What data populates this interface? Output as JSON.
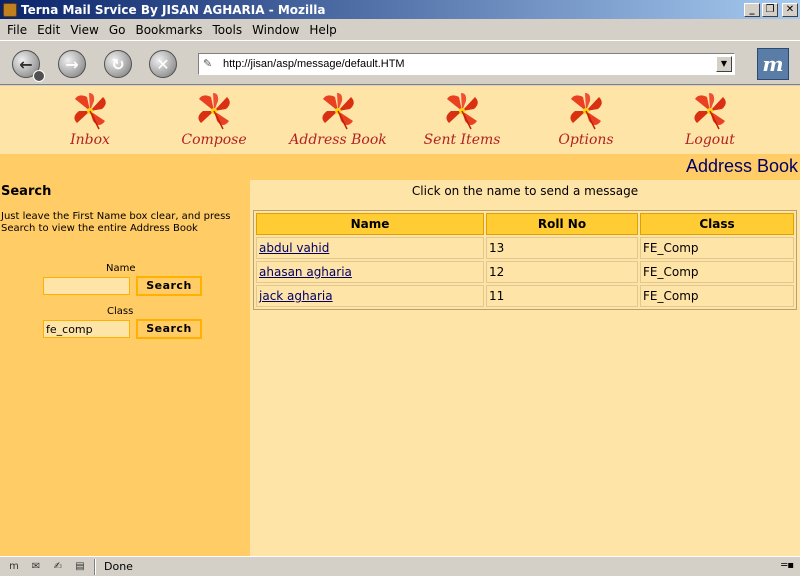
{
  "window": {
    "title": "Terna Mail Srvice By JISAN AGHARIA - Mozilla",
    "controls": [
      "_",
      "❐",
      "✕"
    ]
  },
  "menu": [
    "File",
    "Edit",
    "View",
    "Go",
    "Bookmarks",
    "Tools",
    "Window",
    "Help"
  ],
  "toolbar": {
    "url": "http://jisan/asp/message/default.HTM",
    "icons": [
      "back-icon",
      "forward-icon",
      "reload-icon",
      "stop-icon",
      "mozilla-throbber-icon"
    ]
  },
  "nav": [
    {
      "label": "Inbox",
      "icon": "flower-icon"
    },
    {
      "label": "Compose",
      "icon": "flower-icon"
    },
    {
      "label": "Address Book",
      "icon": "flower-icon"
    },
    {
      "label": "Sent Items",
      "icon": "flower-icon"
    },
    {
      "label": "Options",
      "icon": "flower-icon"
    },
    {
      "label": "Logout",
      "icon": "flower-icon"
    }
  ],
  "page_heading": "Address Book",
  "sidebar": {
    "title": "Search",
    "help": "Just leave the First Name box clear, and press Search to view the entire Address Book",
    "name_label": "Name",
    "name_value": "",
    "class_label": "Class",
    "class_value": "fe_comp",
    "search_label": "Search"
  },
  "main": {
    "instruction": "Click on the name to send a message",
    "columns": [
      "Name",
      "Roll No",
      "Class"
    ],
    "rows": [
      {
        "name": "abdul vahid",
        "roll": "13",
        "class": "FE_Comp"
      },
      {
        "name": "ahasan agharia",
        "roll": "12",
        "class": "FE_Comp"
      },
      {
        "name": "jack agharia",
        "roll": "11",
        "class": "FE_Comp"
      }
    ]
  },
  "status": {
    "text": "Done"
  },
  "colors": {
    "page_bg": "#ffe4a8",
    "accent": "#ffcc66",
    "header_cell": "#ffcc33",
    "nav_text": "#b22222",
    "heading_text": "#000066"
  }
}
